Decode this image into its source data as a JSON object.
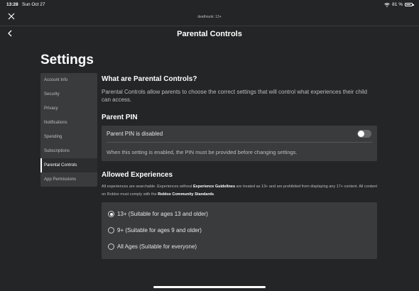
{
  "status": {
    "time": "13:28",
    "date": "Sun Oct 27",
    "battery": "81 %"
  },
  "user_tag": "deathrunk: 13+",
  "header": {
    "title": "Parental Controls"
  },
  "settings_title": "Settings",
  "sidebar": {
    "items": [
      {
        "label": "Account Info"
      },
      {
        "label": "Security"
      },
      {
        "label": "Privacy"
      },
      {
        "label": "Notifications"
      },
      {
        "label": "Spending"
      },
      {
        "label": "Subscriptions"
      },
      {
        "label": "Parental Controls"
      },
      {
        "label": "App Permissions"
      }
    ],
    "active": "Parental Controls"
  },
  "about": {
    "heading": "What are Parental Controls?",
    "text": "Parental Controls allow parents to choose the correct settings that will control what experiences their child can access."
  },
  "pin": {
    "heading": "Parent PIN",
    "status_label": "Parent PIN is disabled",
    "enabled": false,
    "hint": "When this setting is enabled, the PIN must be provided before changing settings."
  },
  "allowed": {
    "heading": "Allowed Experiences",
    "text_1": "All experiences are searchable. Experiences without ",
    "link_1": "Experience Guidelines",
    "text_2": " are treated as 13+ and are prohibited from displaying any 17+ content. All content on Roblox must comply with the ",
    "link_2": "Roblox Community Standards",
    "text_3": ".",
    "options": [
      {
        "label": "13+ (Suitable for ages 13 and older)",
        "checked": true
      },
      {
        "label": "9+ (Suitable for ages 9 and older)",
        "checked": false
      },
      {
        "label": "All Ages (Suitable for everyone)",
        "checked": false
      }
    ]
  },
  "icons": {
    "close": "close-icon",
    "back": "chevron-left-icon",
    "wifi": "wifi-icon",
    "battery": "battery-icon"
  }
}
